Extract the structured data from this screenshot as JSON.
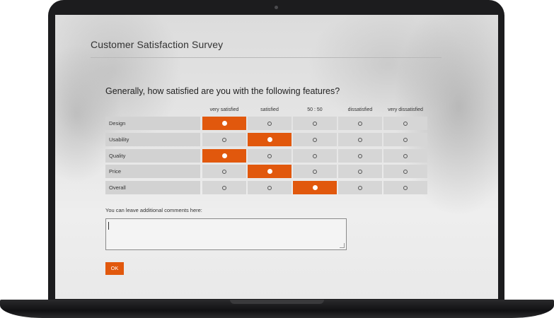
{
  "survey": {
    "title": "Customer Satisfaction Survey",
    "question": "Generally, how satisfied are you with the following features?",
    "columns": [
      "very satisfied",
      "satisfied",
      "50 : 50",
      "dissatisfied",
      "very dissatisfied"
    ],
    "rows": [
      {
        "label": "Design",
        "selected": 0
      },
      {
        "label": "Usability",
        "selected": 1
      },
      {
        "label": "Quality",
        "selected": 0
      },
      {
        "label": "Price",
        "selected": 1
      },
      {
        "label": "Overall",
        "selected": 2
      }
    ],
    "comments_label": "You can leave additional comments here:",
    "comments_value": "",
    "ok_label": "OK"
  },
  "colors": {
    "accent": "#e1580d",
    "cell": "#d6d6d6",
    "laptop": "#1c1c1e"
  }
}
